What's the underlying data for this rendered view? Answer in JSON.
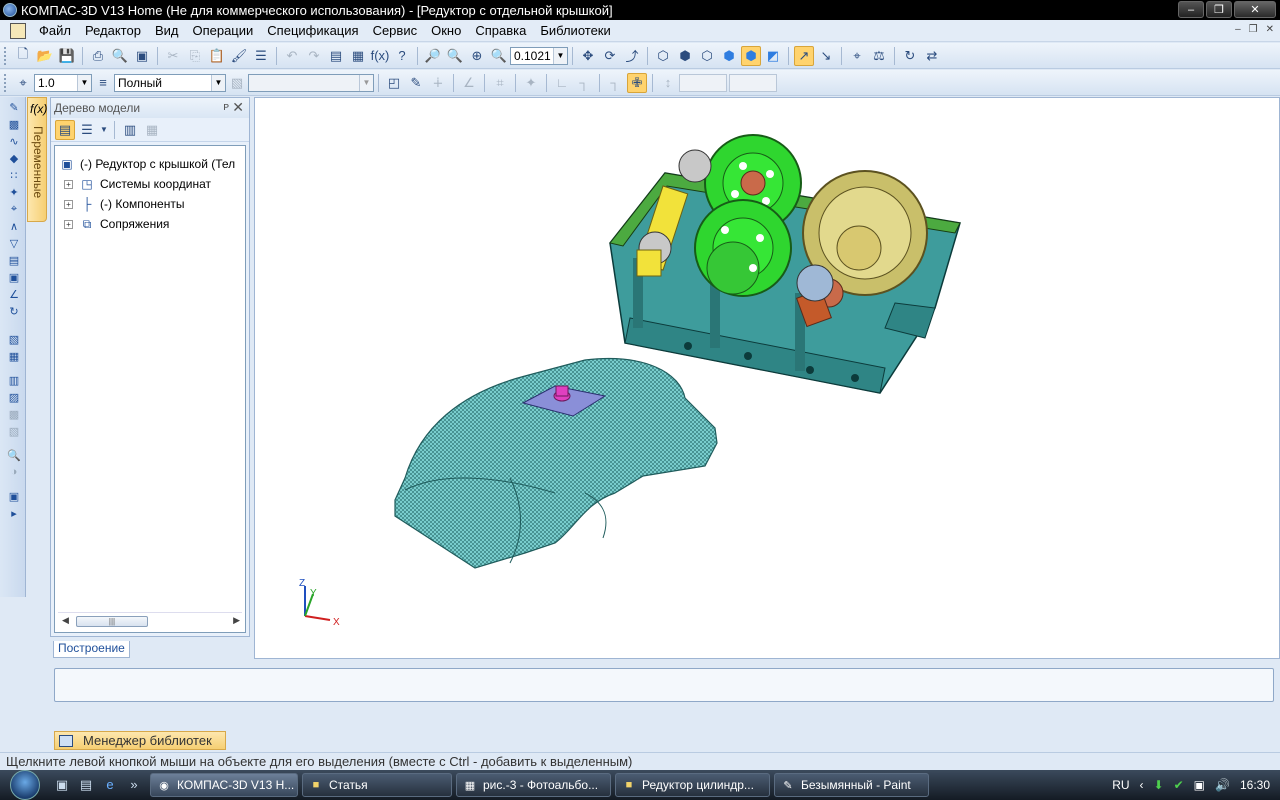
{
  "window": {
    "title": "КОМПАС-3D V13 Home (Не для коммерческого использования) - [Редуктор с отдельной крышкой]"
  },
  "menu": [
    {
      "label": "Файл",
      "u": "Ф"
    },
    {
      "label": "Редактор",
      "u": "Р"
    },
    {
      "label": "Вид",
      "u": "В"
    },
    {
      "label": "Операции",
      "u": "О"
    },
    {
      "label": "Спецификация",
      "u": "С"
    },
    {
      "label": "Сервис",
      "u": "С"
    },
    {
      "label": "Окно",
      "u": "О"
    },
    {
      "label": "Справка",
      "u": "С"
    },
    {
      "label": "Библиотеки",
      "u": "Б"
    }
  ],
  "toolbar": {
    "zoom_value": "0.1021",
    "step_value": "1.0",
    "style_value": "Полный"
  },
  "left_tab": {
    "fx": "f(x)",
    "label": "Переменные"
  },
  "tree": {
    "header": "Дерево модели",
    "pin": "ᴘ",
    "close": "✕",
    "root": "(-) Редуктор с крышкой (Тел",
    "items": [
      {
        "label": "Системы координат"
      },
      {
        "label": "(-) Компоненты"
      },
      {
        "label": "Сопряжения"
      }
    ],
    "scroll_thumb": "|||"
  },
  "tabs": {
    "construction": "Построение"
  },
  "axes": {
    "x": "X",
    "y": "Y",
    "z": "Z"
  },
  "library_manager": "Менеджер библиотек",
  "status": "Щелкните левой кнопкой мыши на объекте для его выделения (вместе с Ctrl - добавить к выделенным)",
  "taskbar": {
    "tasks": [
      {
        "label": "КОМПАС-3D V13 Н...",
        "icon": "kompas-icon"
      },
      {
        "label": "Статья",
        "icon": "folder-icon"
      },
      {
        "label": "рис.-3 - Фотоальбо...",
        "icon": "photo-icon"
      },
      {
        "label": "Редуктор цилиндр...",
        "icon": "folder-icon"
      },
      {
        "label": "Безымянный - Paint",
        "icon": "paint-icon"
      }
    ],
    "lang": "RU",
    "time": "16:30"
  }
}
